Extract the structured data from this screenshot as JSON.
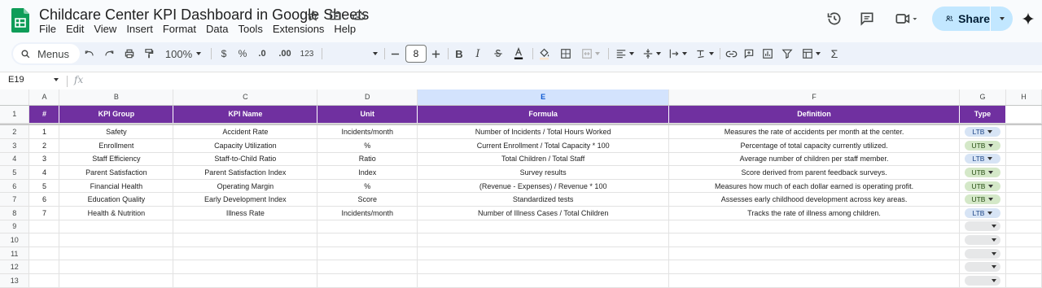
{
  "app": {
    "title": "Childcare Center KPI Dashboard in Google Sheets",
    "menu": [
      "File",
      "Edit",
      "View",
      "Insert",
      "Format",
      "Data",
      "Tools",
      "Extensions",
      "Help"
    ],
    "share_label": "Share"
  },
  "toolbar": {
    "menus_label": "Menus",
    "zoom": "100%",
    "currency": "$",
    "percent": "%",
    "dec_minus": ".0",
    "dec_plus": ".00",
    "number_format": "123",
    "font_size": "8",
    "bold": "B",
    "italic": "I"
  },
  "formula_bar": {
    "cell_ref": "E19",
    "fx": "fx"
  },
  "sheet": {
    "columns": [
      "A",
      "B",
      "C",
      "D",
      "E",
      "F",
      "G",
      "H"
    ],
    "headers": [
      "#",
      "KPI Group",
      "KPI Name",
      "Unit",
      "Formula",
      "Definition",
      "Type"
    ],
    "rows": [
      [
        "1",
        "Safety",
        "Accident Rate",
        "Incidents/month",
        "Number of Incidents / Total Hours Worked",
        "Measures the rate of accidents per month at the center.",
        "LTB"
      ],
      [
        "2",
        "Enrollment",
        "Capacity Utilization",
        "%",
        "Current Enrollment / Total Capacity * 100",
        "Percentage of total capacity currently utilized.",
        "UTB"
      ],
      [
        "3",
        "Staff Efficiency",
        "Staff-to-Child Ratio",
        "Ratio",
        "Total Children / Total Staff",
        "Average number of children per staff member.",
        "LTB"
      ],
      [
        "4",
        "Parent Satisfaction",
        "Parent Satisfaction Index",
        "Index",
        "Survey results",
        "Score derived from parent feedback surveys.",
        "UTB"
      ],
      [
        "5",
        "Financial Health",
        "Operating Margin",
        "%",
        "(Revenue - Expenses) / Revenue * 100",
        "Measures how much of each dollar earned is operating profit.",
        "UTB"
      ],
      [
        "6",
        "Education Quality",
        "Early Development Index",
        "Score",
        "Standardized tests",
        "Assesses early childhood development across key areas.",
        "UTB"
      ],
      [
        "7",
        "Health & Nutrition",
        "Illness Rate",
        "Incidents/month",
        "Number of Illness Cases / Total Children",
        "Tracks the rate of illness among children.",
        "LTB"
      ]
    ],
    "row_numbers": [
      "1",
      "2",
      "3",
      "4",
      "5",
      "6",
      "7",
      "8",
      "9",
      "10",
      "11",
      "12",
      "13"
    ],
    "selected_column": "E"
  },
  "colors": {
    "header_bg": "#7030a0",
    "ltb_bg": "#d7e4f5",
    "utb_bg": "#d4e8c8",
    "share_bg": "#c2e7ff"
  }
}
